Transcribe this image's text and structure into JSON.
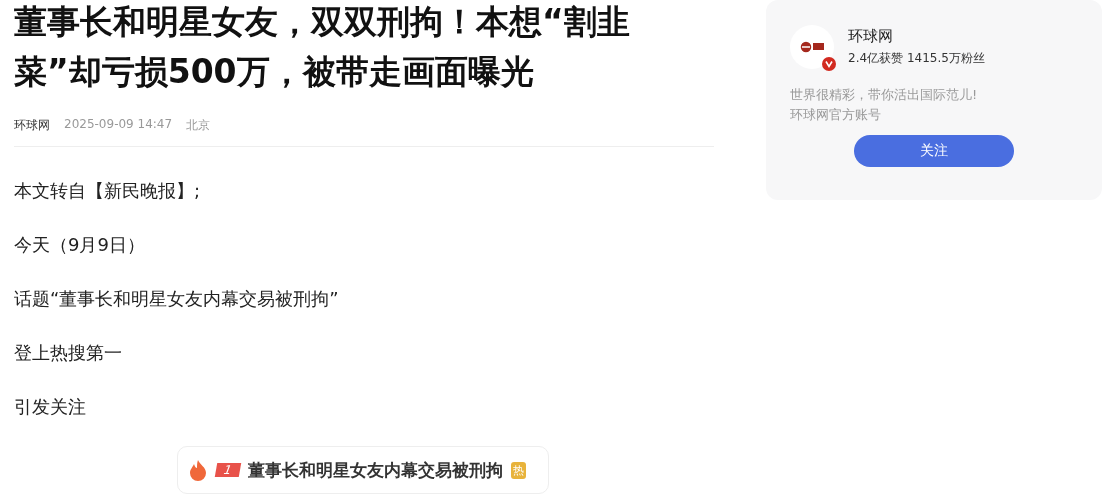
{
  "article": {
    "title": "董事长和明星女友，双双刑拘！本想“割韭菜”却亏损500万，被带走画面曝光",
    "source": "环球网",
    "time": "2025-09-09 14:47",
    "location": "北京",
    "paragraphs": [
      "本文转自【新民晚报】;",
      "今天（9月9日）",
      "话题“董事长和明星女友内幕交易被刑拘”",
      "登上热搜第一",
      "引发关注"
    ],
    "hot_search": {
      "rank": "1",
      "topic": "董事长和明星女友内幕交易被刑拘",
      "badge": "热"
    }
  },
  "author_card": {
    "name": "环球网",
    "verified": true,
    "stats": "2.4亿获赞 1415.5万粉丝",
    "bio": [
      "世界很精彩，带你活出国际范儿!",
      "环球网官方账号"
    ],
    "follow_button": "关注"
  }
}
